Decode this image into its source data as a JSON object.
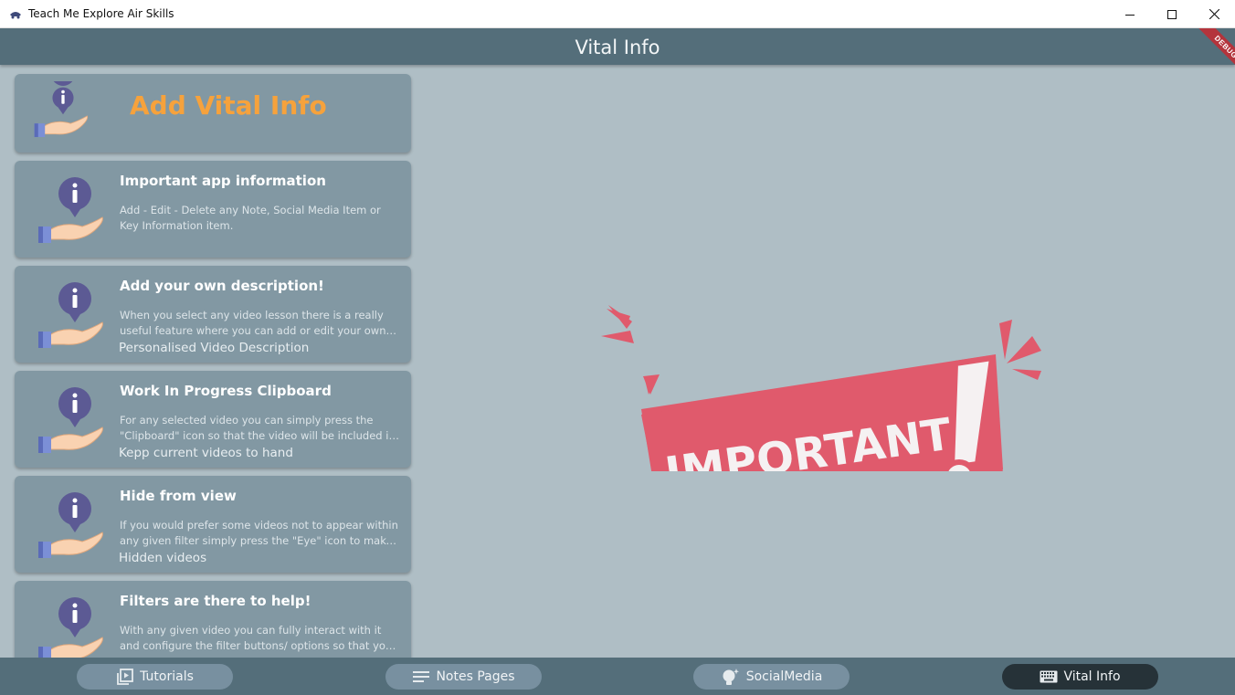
{
  "window": {
    "title": "Teach Me Explore Air Skills"
  },
  "appbar": {
    "title": "Vital Info",
    "debug_label": "DEBUG"
  },
  "header_card": {
    "title": "Add Vital Info"
  },
  "cards": [
    {
      "title": "Important app information",
      "description": "Add - Edit - Delete any Note, Social Media Item or Key Information item.",
      "subtitle": ""
    },
    {
      "title": "Add your own description!",
      "description": "When you select any video lesson there is a really useful feature where you can add or edit your own Video description",
      "subtitle": "Personalised Video Description"
    },
    {
      "title": "Work In Progress Clipboard",
      "description": "For any selected video you can simply press the \"Clipboard\" icon so that the video will be included in your Work In Progress list",
      "subtitle": "Kepp current videos to hand"
    },
    {
      "title": "Hide from view",
      "description": "If you would prefer some videos not to appear within any given filter simply press the \"Eye\" icon to make them hidden",
      "subtitle": "Hidden videos"
    },
    {
      "title": "Filters are there to help!",
      "description": "With any given video you can fully interact with it and configure the filter buttons/ options so that you remember",
      "subtitle": ""
    }
  ],
  "banner": {
    "text": "IMPORTANT"
  },
  "nav": {
    "tutorials": "Tutorials",
    "notes": "Notes Pages",
    "social": "SocialMedia",
    "vital": "Vital Info"
  },
  "colors": {
    "appbar": "#546e7a",
    "body": "#afbec5",
    "card": "#8298a3",
    "accent": "#f6a23c",
    "banner": "#e05a6c",
    "active_nav": "#263238"
  }
}
